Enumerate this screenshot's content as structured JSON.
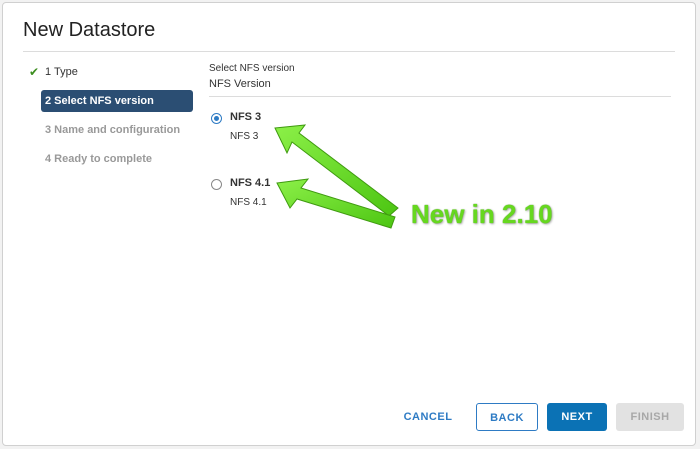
{
  "dialog": {
    "title": "New Datastore"
  },
  "steps": [
    {
      "label": "1 Type",
      "state": "done"
    },
    {
      "label": "2 Select NFS version",
      "state": "active"
    },
    {
      "label": "3 Name and configuration",
      "state": "disabled"
    },
    {
      "label": "4 Ready to complete",
      "state": "disabled"
    }
  ],
  "content": {
    "section_label": "Select NFS version",
    "field_label": "NFS Version",
    "options": [
      {
        "label": "NFS 3",
        "description": "NFS 3",
        "selected": true
      },
      {
        "label": "NFS 4.1",
        "description": "NFS 4.1",
        "selected": false
      }
    ]
  },
  "annotation": {
    "text": "New in 2.10",
    "color": "#66d81f"
  },
  "footer": {
    "cancel_label": "CANCEL",
    "back_label": "BACK",
    "next_label": "NEXT",
    "finish_label": "FINISH"
  },
  "colors": {
    "active_step_bg": "#2b4e73",
    "primary_button": "#0b72b5",
    "link_blue": "#2e7bc4",
    "check_green": "#3c8e1f"
  }
}
